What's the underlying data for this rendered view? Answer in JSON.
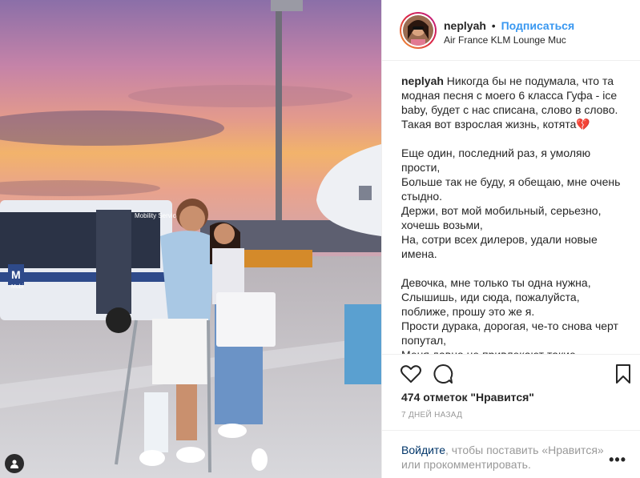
{
  "post": {
    "username": "neplyah",
    "separator": "•",
    "follow_label": "Подписаться",
    "location": "Air France KLM Lounge Muc",
    "caption_user": "neplyah",
    "caption_lines": [
      "Никогда бы не подумала, что та",
      "модная песня с моего 6 класса Гуфа - ice",
      "baby, будет с нас списана, слово в слово.",
      "Такая вот взрослая жизнь, котята💔",
      "",
      "Еще один, последний раз, я умоляю",
      "прости,",
      "Больше так не буду, я обещаю, мне очень",
      "стыдно.",
      "Держи, вот мой мобильный, серьезно,",
      "хочешь возьми,",
      "На, сотри всех дилеров, удали новые",
      "имена.",
      "",
      "Девочка, мне только ты одна нужна,",
      "Слышишь, иди сюда, пожалуйста,",
      "поближе, прошу это же я.",
      "Прости дурака, дорогая, че-то снова черт",
      "попутал,",
      "Меня давно не привлекают такие"
    ],
    "likes": "474 отметок \"Нравится\"",
    "time": "7 ДНЕЙ НАЗАД",
    "login_link": "Войдите",
    "login_text_1": ", чтобы поставить «Нравится»",
    "login_text_2": "или прокомментировать.",
    "more_label": "•••",
    "photo_sign": "Mobility Service",
    "photo_bus_letter": "M",
    "photo_bus_small": "Mobi"
  },
  "icons": {
    "like": "heart-icon",
    "comment": "comment-icon",
    "save": "bookmark-icon",
    "tag": "user-tag-icon",
    "more": "more-options-icon"
  },
  "colors": {
    "follow": "#3897f0",
    "link": "#003569",
    "muted": "#999999",
    "text": "#262626"
  }
}
